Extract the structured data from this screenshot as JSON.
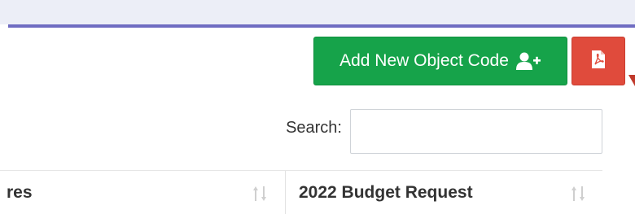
{
  "toolbar": {
    "add_label": "Add New Object Code",
    "add_icon": "user-plus-icon",
    "pdf_icon": "file-pdf-icon",
    "add_color": "#16a34a",
    "pdf_color": "#e04b3c"
  },
  "search": {
    "label": "Search:",
    "value": "",
    "placeholder": ""
  },
  "table": {
    "columns": [
      {
        "label": "res",
        "sort_icon": "sort-icon"
      },
      {
        "label": "2022 Budget Request",
        "sort_icon": "sort-icon"
      }
    ]
  },
  "theme": {
    "accent_rule": "#6f6cc2"
  }
}
